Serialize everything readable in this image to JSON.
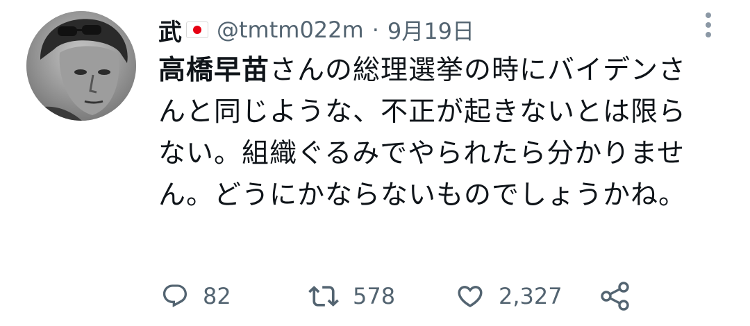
{
  "tweet": {
    "display_name": "武",
    "handle": "@tmtm022m",
    "separator": "·",
    "date": "9月19日",
    "text_bold": "高橋早苗",
    "text_rest": "さんの総理選挙の時にバイデンさんと同じような、不正が起きないとは限らない。組織ぐるみでやられたら分かりません。どうにかならないものでしょうかね。",
    "flag_icon": "japan-flag-icon",
    "colors": {
      "text": "#0f1419",
      "secondary": "#536471",
      "flag_red": "#e60012"
    }
  },
  "actions": {
    "reply_count": "82",
    "retweet_count": "578",
    "like_count": "2,327",
    "reply_icon": "reply-icon",
    "retweet_icon": "retweet-icon",
    "like_icon": "heart-icon",
    "share_icon": "share-icon"
  }
}
